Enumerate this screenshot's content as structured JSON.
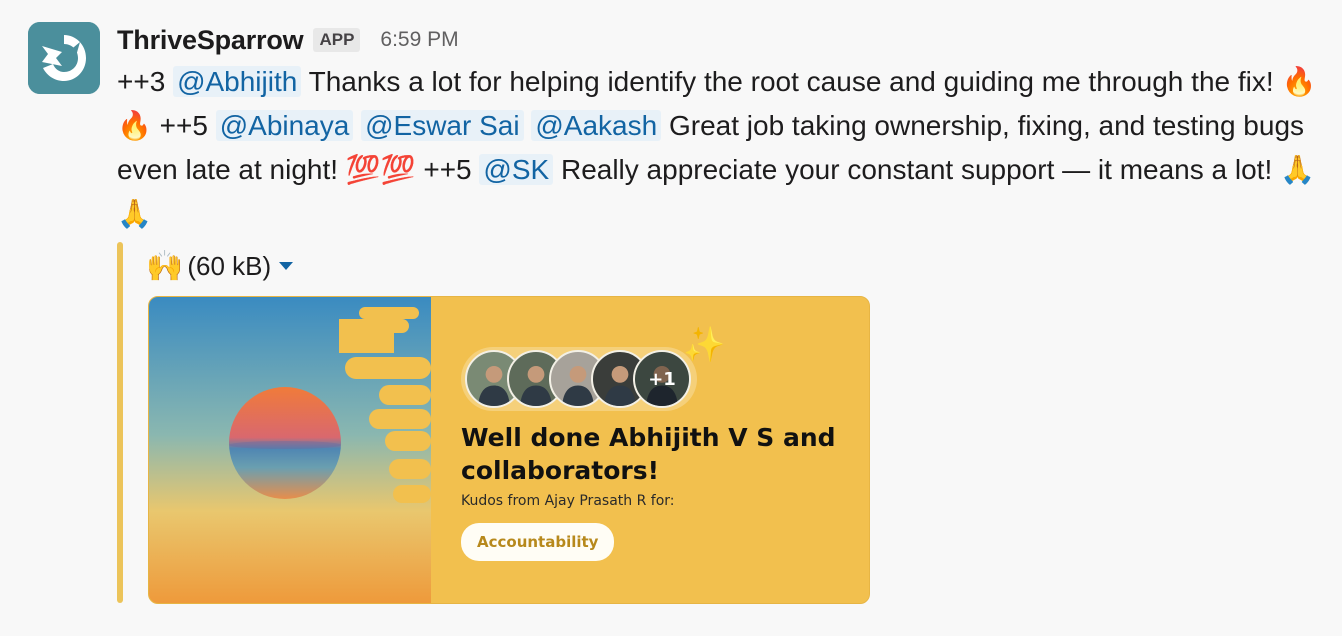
{
  "message": {
    "sender": "ThriveSparrow",
    "badge": "APP",
    "time": "6:59 PM",
    "segments": [
      {
        "t": "text",
        "v": "++3 "
      },
      {
        "t": "mention",
        "v": "@Abhijith"
      },
      {
        "t": "text",
        "v": " Thanks a lot for helping identify the root cause and guiding me through the fix! "
      },
      {
        "t": "emoji",
        "v": "🔥🔥"
      },
      {
        "t": "text",
        "v": " ++5 "
      },
      {
        "t": "mention",
        "v": "@Abinaya"
      },
      {
        "t": "text",
        "v": " "
      },
      {
        "t": "mention",
        "v": "@Eswar Sai"
      },
      {
        "t": "text",
        "v": " "
      },
      {
        "t": "mention",
        "v": "@Aakash"
      },
      {
        "t": "text",
        "v": " Great job taking ownership, fixing, and testing bugs even late at night! "
      },
      {
        "t": "emoji",
        "v": "💯💯"
      },
      {
        "t": "text",
        "v": " ++5 "
      },
      {
        "t": "mention",
        "v": "@SK"
      },
      {
        "t": "text",
        "v": " Really appreciate your constant support — it means a lot! "
      },
      {
        "t": "emoji",
        "v": "🙏🙏"
      }
    ]
  },
  "attachment": {
    "emoji": "🙌",
    "size": "(60 kB)",
    "card": {
      "people": [
        {
          "icon": "person-avatar",
          "color": "#7a8a74"
        },
        {
          "icon": "person-avatar",
          "color": "#5e6b5a"
        },
        {
          "icon": "person-avatar",
          "color": "#a7a29a"
        },
        {
          "icon": "person-avatar",
          "color": "#3a3d3a"
        },
        {
          "icon": "person-avatar",
          "color": "#5d6d63",
          "overlay": "+1"
        }
      ],
      "sparkle": "✨",
      "title": "Well done Abhijith V S and collaborators!",
      "subtitle": "Kudos from Ajay Prasath R for:",
      "value": "Accountability"
    }
  },
  "colors": {
    "mention_bg": "#e8f1f8",
    "mention_fg": "#1264a3",
    "card_bg": "#f2c04e",
    "accent_bar": "#ecc45a",
    "brand": "#4b8f9c"
  }
}
